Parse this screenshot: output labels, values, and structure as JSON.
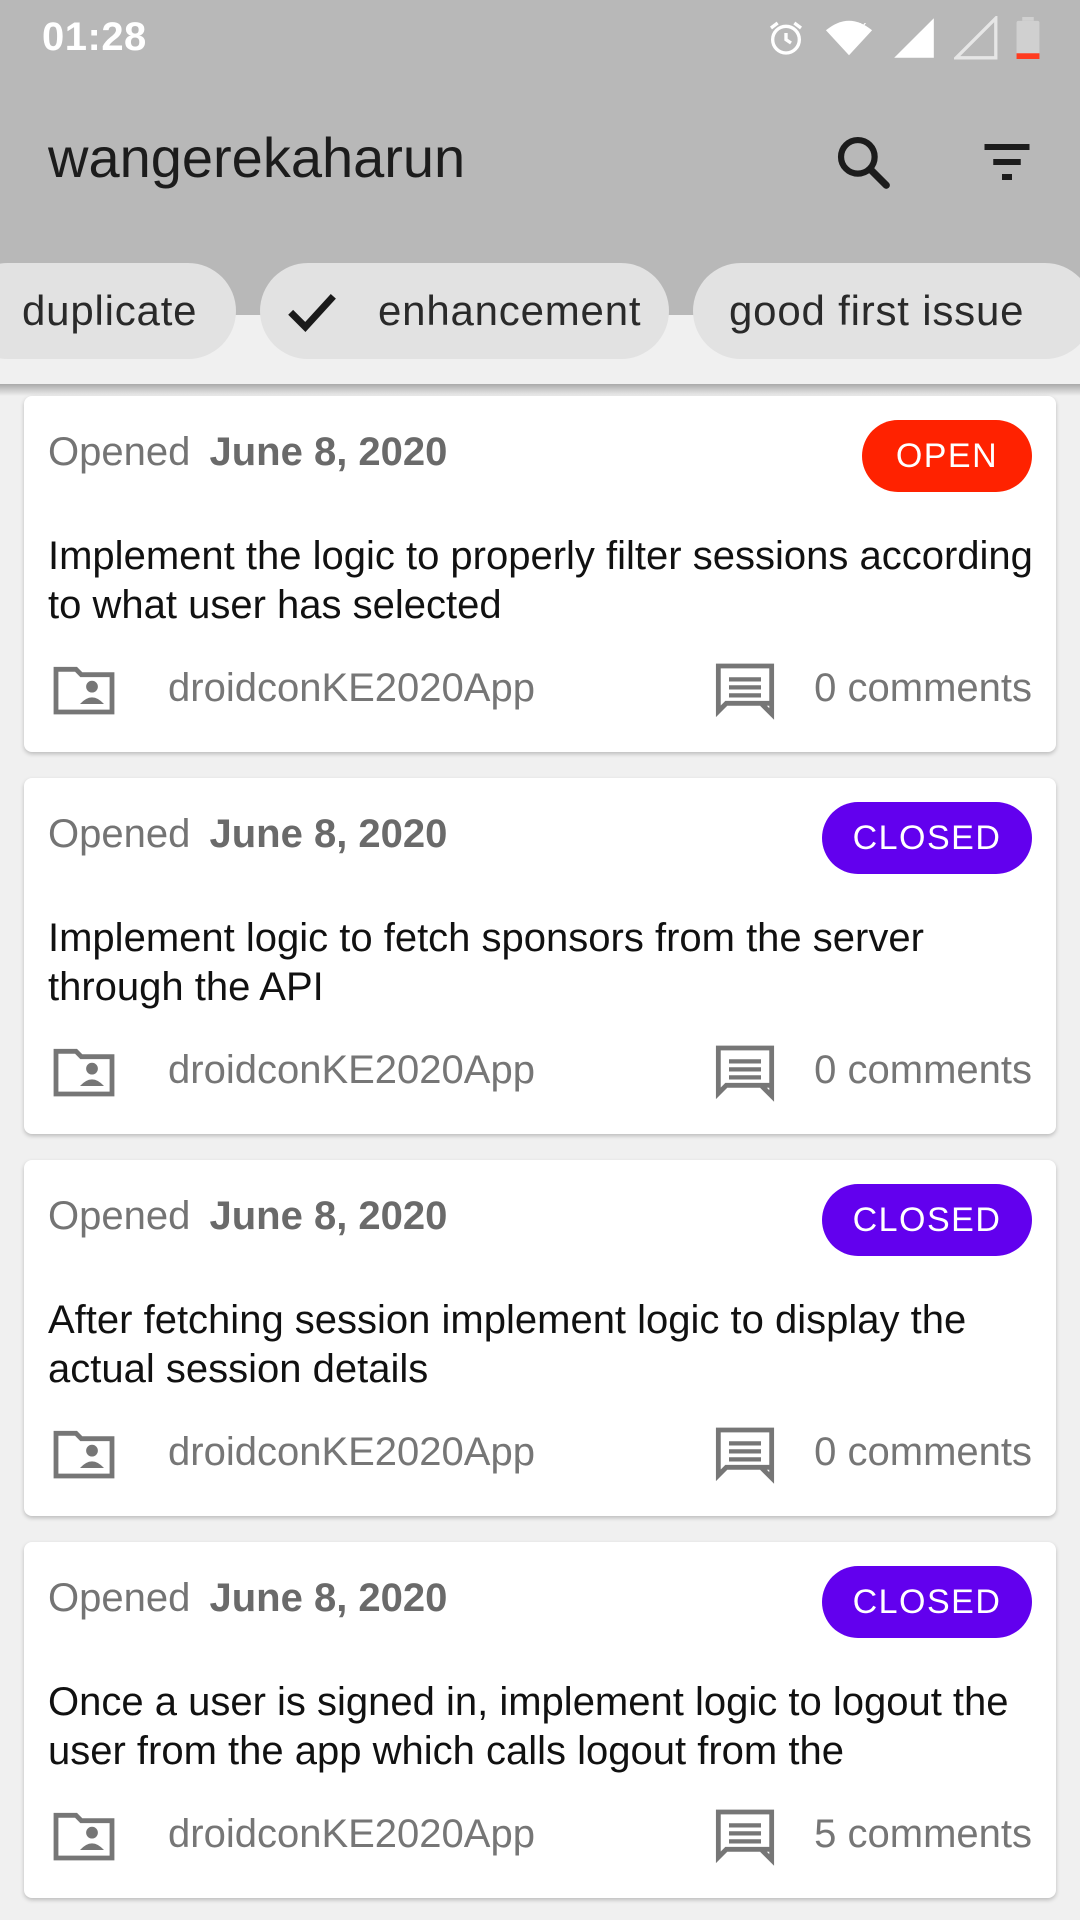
{
  "status_bar": {
    "time": "01:28"
  },
  "app_bar": {
    "title": "wangerekaharun",
    "search_icon": "search-icon",
    "filter_icon": "filter-icon"
  },
  "chips": [
    {
      "label": "duplicate",
      "selected": false
    },
    {
      "label": "enhancement",
      "selected": true
    },
    {
      "label": "good first issue",
      "selected": false
    }
  ],
  "issues": [
    {
      "opened_prefix": "Opened",
      "date": "June 8, 2020",
      "status": "OPEN",
      "title": "Implement the logic to properly filter sessions according to what user has selected",
      "repo": "droidconKE2020App",
      "comments": "0 comments"
    },
    {
      "opened_prefix": "Opened",
      "date": "June 8, 2020",
      "status": "CLOSED",
      "title": "Implement logic to fetch sponsors from the server through the API",
      "repo": "droidconKE2020App",
      "comments": "0 comments"
    },
    {
      "opened_prefix": "Opened",
      "date": "June 8, 2020",
      "status": "CLOSED",
      "title": "After fetching session implement logic to display the actual session details",
      "repo": "droidconKE2020App",
      "comments": "0 comments"
    },
    {
      "opened_prefix": "Opened",
      "date": "June 8, 2020",
      "status": "CLOSED",
      "title": "Once a user is signed in, implement logic to logout the user from the app which calls logout from the",
      "repo": "droidconKE2020App",
      "comments": "5 comments"
    }
  ],
  "colors": {
    "open_badge": "#ff2200",
    "closed_badge": "#6200ee",
    "app_bar": "#b8b8b8"
  }
}
